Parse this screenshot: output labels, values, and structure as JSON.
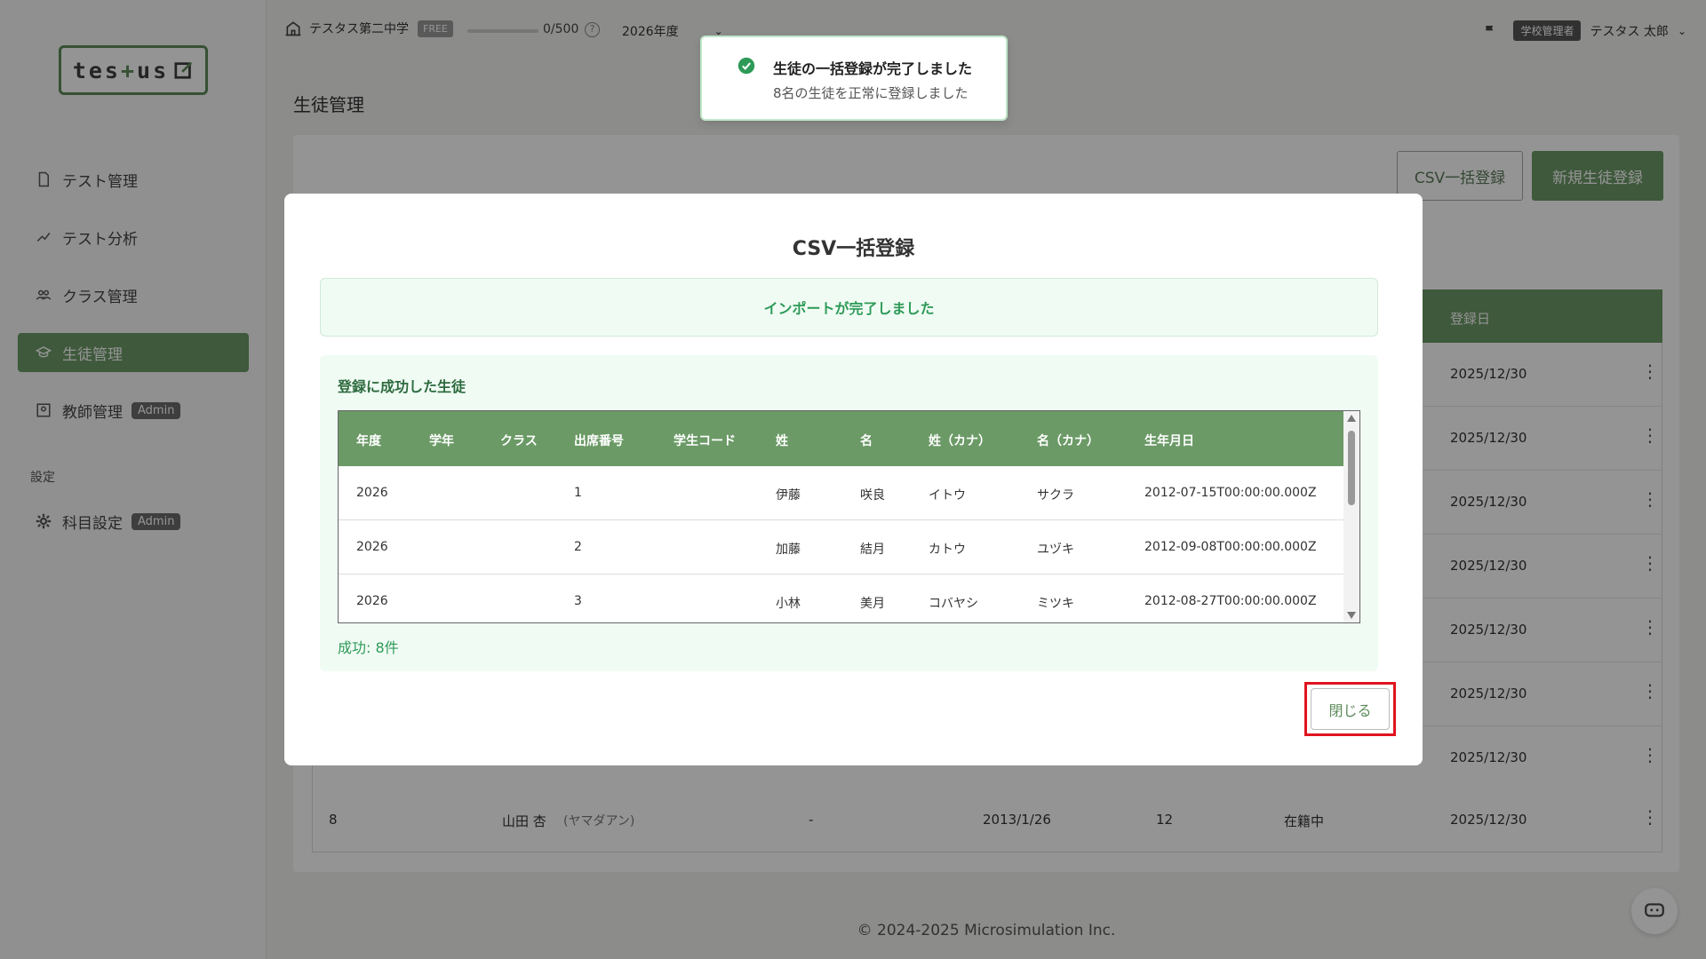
{
  "colors": {
    "brand_green": "#6b9a66",
    "success_green": "#2e9a57",
    "highlight_red": "#e0141e"
  },
  "logo": {
    "text_a": "tes",
    "text_b": "+",
    "text_c": "us"
  },
  "sidebar": {
    "items": [
      {
        "label": "テスト管理",
        "icon": "document-icon"
      },
      {
        "label": "テスト分析",
        "icon": "analysis-icon"
      },
      {
        "label": "クラス管理",
        "icon": "group-icon"
      },
      {
        "label": "生徒管理",
        "icon": "student-icon",
        "active": true
      },
      {
        "label": "教師管理",
        "icon": "teacher-icon",
        "badge": "Admin"
      }
    ],
    "section_label": "設定",
    "settings_items": [
      {
        "label": "科目設定",
        "icon": "gear-icon",
        "badge": "Admin"
      }
    ]
  },
  "header": {
    "school_name": "テスタス第二中学",
    "plan_badge": "FREE",
    "usage": "0/500",
    "help": "?",
    "year": "2026年度",
    "role_badge": "学校管理者",
    "user_name": "テスタス 太郎"
  },
  "page": {
    "title": "生徒管理",
    "csv_button": "CSV一括登録",
    "new_button": "新規生徒登録",
    "table_header_date": "登録日",
    "rows": [
      {
        "date": "2025/12/30"
      },
      {
        "date": "2025/12/30"
      },
      {
        "date": "2025/12/30"
      },
      {
        "date": "2025/12/30"
      },
      {
        "date": "2025/12/30"
      },
      {
        "date": "2025/12/30"
      },
      {
        "date": "2025/12/30"
      },
      {
        "no": "8",
        "name": "山田 杏",
        "kana": "(ヤマダアン)",
        "dash": "-",
        "birth": "2013/1/26",
        "grade": "12",
        "status": "在籍中",
        "date": "2025/12/30"
      }
    ]
  },
  "footer": {
    "copyright": "© 2024-2025 Microsimulation Inc."
  },
  "toast": {
    "title": "生徒の一括登録が完了しました",
    "message": "8名の生徒を正常に登録しました"
  },
  "modal": {
    "title": "CSV一括登録",
    "banner": "インポートが完了しました",
    "success_title": "登録に成功した生徒",
    "columns": [
      "年度",
      "学年",
      "クラス",
      "出席番号",
      "学生コード",
      "姓",
      "名",
      "姓（カナ）",
      "名（カナ）",
      "生年月日"
    ],
    "rows": [
      {
        "year": "2026",
        "grade": "",
        "class": "",
        "number": "1",
        "code": "",
        "last": "伊藤",
        "first": "咲良",
        "last_kana": "イトウ",
        "first_kana": "サクラ",
        "birth": "2012-07-15T00:00:00.000Z"
      },
      {
        "year": "2026",
        "grade": "",
        "class": "",
        "number": "2",
        "code": "",
        "last": "加藤",
        "first": "結月",
        "last_kana": "カトウ",
        "first_kana": "ユヅキ",
        "birth": "2012-09-08T00:00:00.000Z"
      },
      {
        "year": "2026",
        "grade": "",
        "class": "",
        "number": "3",
        "code": "",
        "last": "小林",
        "first": "美月",
        "last_kana": "コバヤシ",
        "first_kana": "ミツキ",
        "birth": "2012-08-27T00:00:00.000Z"
      }
    ],
    "success_count": "成功: 8件",
    "close_button": "閉じる"
  }
}
